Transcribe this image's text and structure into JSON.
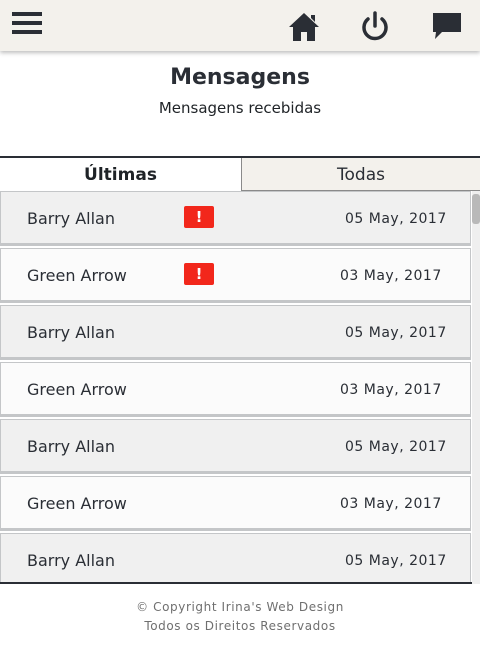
{
  "header": {
    "icons": [
      "menu-icon",
      "home-icon",
      "power-icon",
      "chat-icon"
    ]
  },
  "page": {
    "title": "Mensagens",
    "subtitle": "Mensagens recebidas"
  },
  "tabs": [
    {
      "label": "Últimas",
      "active": true
    },
    {
      "label": "Todas",
      "active": false
    }
  ],
  "messages": [
    {
      "sender": "Barry Allan",
      "alert": "!",
      "date": "05 May, 2017"
    },
    {
      "sender": "Green Arrow",
      "alert": "!",
      "date": "03 May, 2017"
    },
    {
      "sender": "Barry Allan",
      "alert": "",
      "date": "05 May, 2017"
    },
    {
      "sender": "Green Arrow",
      "alert": "",
      "date": "03 May, 2017"
    },
    {
      "sender": "Barry Allan",
      "alert": "",
      "date": "05 May, 2017"
    },
    {
      "sender": "Green Arrow",
      "alert": "",
      "date": "03 May, 2017"
    },
    {
      "sender": "Barry Allan",
      "alert": "",
      "date": "05 May, 2017"
    }
  ],
  "footer": {
    "copyright": "© Copyright Irina's Web Design",
    "rights": "Todos os Direitos Reservados"
  },
  "colors": {
    "header_bg": "#f3f1ec",
    "text_dark": "#2a2e35",
    "alert_red": "#f2271b"
  }
}
